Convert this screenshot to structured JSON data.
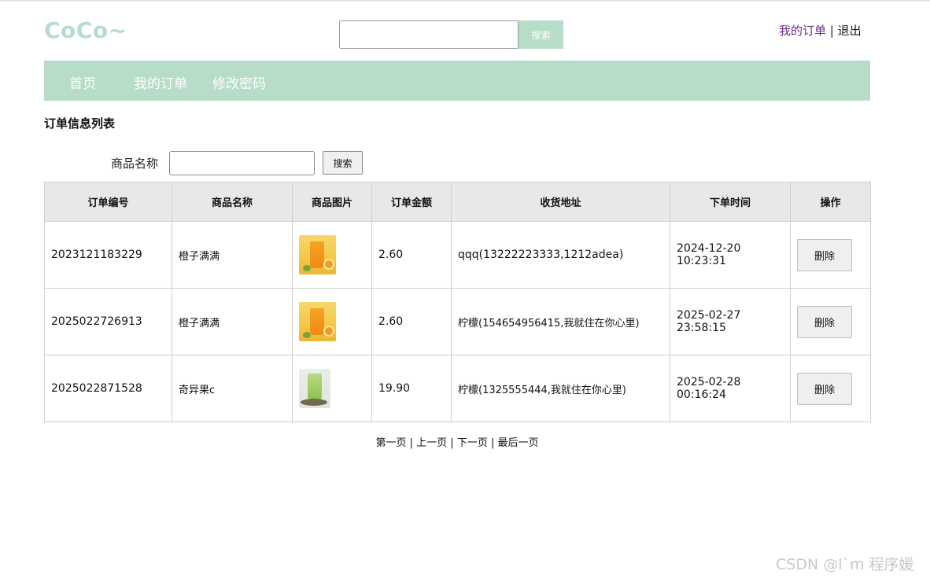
{
  "header": {
    "logo": "CoCo~",
    "search_value": "",
    "search_button": "搜索",
    "orders_link": "我的订单",
    "separator": "|",
    "logout_link": "退出"
  },
  "nav": {
    "items": [
      {
        "label": "首页"
      },
      {
        "label": "我的订单"
      },
      {
        "label": "修改密码"
      }
    ]
  },
  "main": {
    "title": "订单信息列表",
    "filter_label": "商品名称",
    "filter_value": "",
    "filter_button": "搜索"
  },
  "table": {
    "headers": [
      "订单编号",
      "商品名称",
      "商品图片",
      "订单金额",
      "收货地址",
      "下单时间",
      "操作"
    ],
    "rows": [
      {
        "order_no": "2023121183229",
        "product": "橙子满满",
        "image": "orange-drink-image",
        "amount": "2.60",
        "address": "qqq(13222223333,1212adea)",
        "date": "2024-12-20",
        "time": "10:23:31",
        "action": "删除"
      },
      {
        "order_no": "2025022726913",
        "product": "橙子满满",
        "image": "orange-drink-image",
        "amount": "2.60",
        "address": "柠檬(154654956415,我就住在你心里)",
        "date": "2025-02-27",
        "time": "23:58:15",
        "action": "删除"
      },
      {
        "order_no": "2025022871528",
        "product": "奇异果c",
        "image": "kiwi-drink-image",
        "amount": "19.90",
        "address": "柠檬(1325555444,我就住在你心里)",
        "date": "2025-02-28",
        "time": "00:16:24",
        "action": "删除"
      }
    ]
  },
  "pagination": {
    "first": "第一页",
    "prev": "上一页",
    "next": "下一页",
    "last": "最后一页",
    "separator": "|"
  },
  "watermark": "CSDN @l`m 程序媛",
  "colors": {
    "accent": "#b7dcc8",
    "link_visited": "#6a2c8f",
    "table_header": "#e8e8e8"
  }
}
